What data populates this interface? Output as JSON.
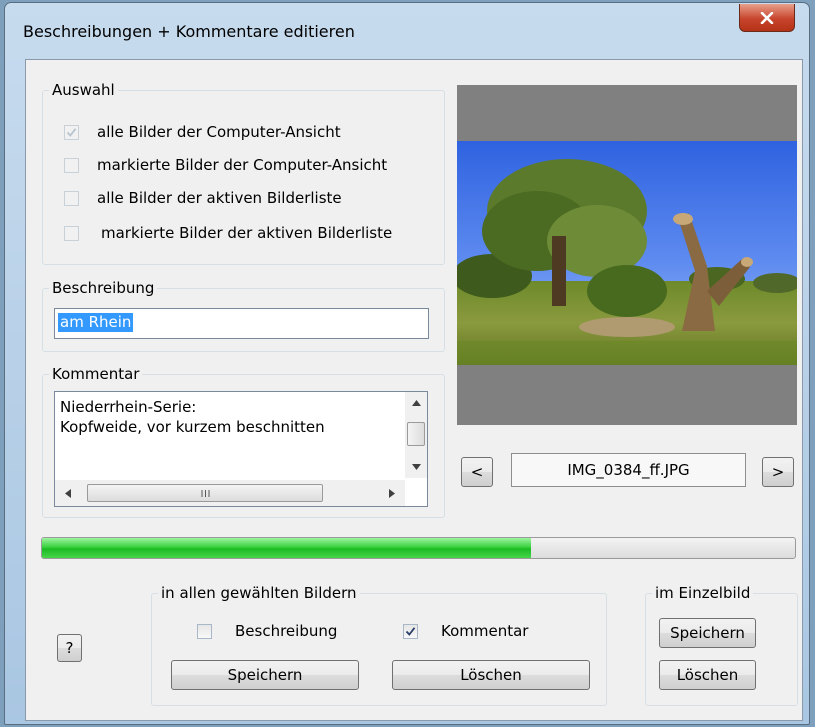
{
  "window": {
    "title": "Beschreibungen + Kommentare editieren"
  },
  "auswahl": {
    "legend": "Auswahl",
    "options": [
      {
        "label": "alle Bilder der Computer-Ansicht",
        "checked": true,
        "enabled": false
      },
      {
        "label": "markierte Bilder der Computer-Ansicht",
        "checked": false,
        "enabled": false
      },
      {
        "label": "alle Bilder der aktiven Bilderliste",
        "checked": false,
        "enabled": true
      },
      {
        "label": "markierte Bilder der aktiven Bilderliste",
        "checked": false,
        "enabled": false
      }
    ]
  },
  "beschreibung": {
    "legend": "Beschreibung",
    "value": "am Rhein"
  },
  "kommentar": {
    "legend": "Kommentar",
    "value": "Niederrhein-Serie:\nKopfweide, vor kurzem beschnitten"
  },
  "preview": {
    "filename": "IMG_0384_ff.JPG",
    "prev_label": "<",
    "next_label": ">"
  },
  "progress": {
    "fraction": 0.65
  },
  "alle_bilder": {
    "legend": "in allen gewählten Bildern",
    "cb_beschreibung": {
      "label": "Beschreibung",
      "checked": false
    },
    "cb_kommentar": {
      "label": "Kommentar",
      "checked": true
    },
    "save_label": "Speichern",
    "delete_label": "Löschen"
  },
  "einzelbild": {
    "legend": "im Einzelbild",
    "save_label": "Speichern",
    "delete_label": "Löschen"
  },
  "help_label": "?",
  "icons": {
    "close": "close-icon",
    "check": "checkmark-icon"
  },
  "colors": {
    "selection": "#3399ff",
    "progress": "#1cbb25",
    "close": "#c7452c"
  }
}
